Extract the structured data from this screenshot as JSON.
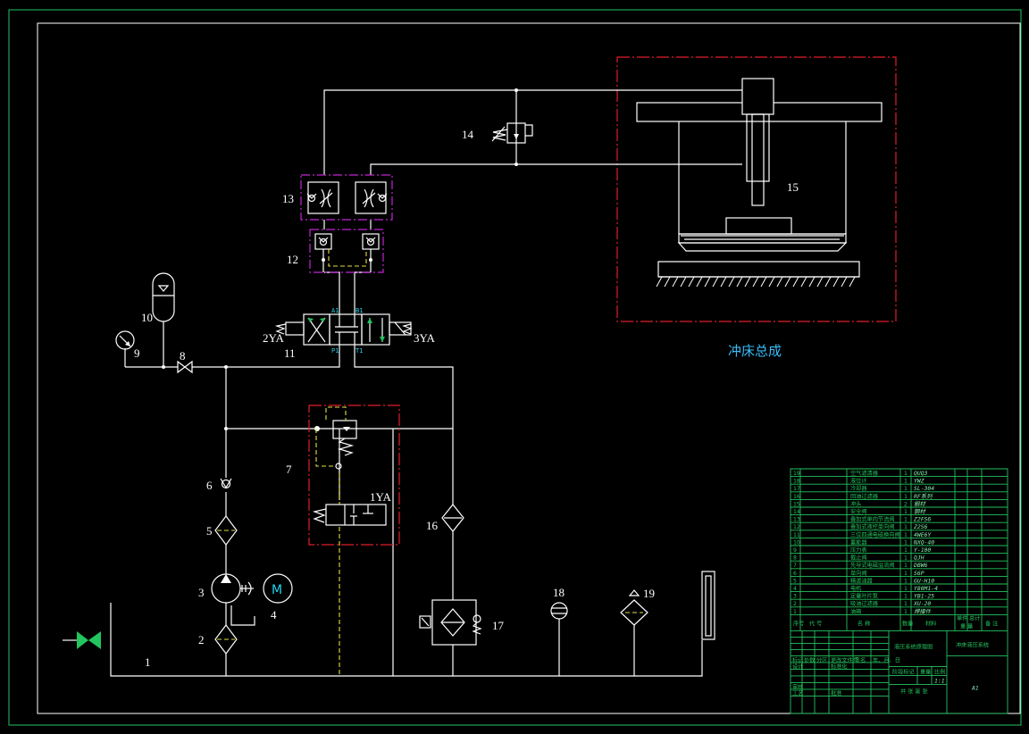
{
  "labels": {
    "n1": "1",
    "n2": "2",
    "n3": "3",
    "n4": "4",
    "n5": "5",
    "n6": "6",
    "n7": "7",
    "n8": "8",
    "n9": "9",
    "n10": "10",
    "n11": "11",
    "n12": "12",
    "n13": "13",
    "n14": "14",
    "n15": "15",
    "n16": "16",
    "n17": "17",
    "n18": "18",
    "n19": "19",
    "sol_1ya": "1YA",
    "sol_2ya": "2YA",
    "sol_3ya": "3YA",
    "port_a1": "A1",
    "port_b1": "B1",
    "port_p1": "P1",
    "port_t1": "T1",
    "motor_m": "M",
    "press_assembly": "冲床总成"
  },
  "title_block": {
    "parts": [
      {
        "no": "19",
        "name": "空气滤清器",
        "qty": "1",
        "spec": "QUQ3"
      },
      {
        "no": "18",
        "name": "液位计",
        "qty": "1",
        "spec": "YWZ"
      },
      {
        "no": "17",
        "name": "冷却器",
        "qty": "1",
        "spec": "SL-304"
      },
      {
        "no": "16",
        "name": "回油过滤器",
        "qty": "1",
        "spec": "RF系列"
      },
      {
        "no": "15",
        "name": "冲头",
        "qty": "2",
        "spec": "钢材"
      },
      {
        "no": "14",
        "name": "安全阀",
        "qty": "1",
        "spec": "钢材"
      },
      {
        "no": "13",
        "name": "叠加式单向节流阀",
        "qty": "1",
        "spec": "Z2FS6"
      },
      {
        "no": "12",
        "name": "叠加式液控单向阀",
        "qty": "1",
        "spec": "Z2S6"
      },
      {
        "no": "11",
        "name": "三位四通电磁换向阀",
        "qty": "1",
        "spec": "4WE6Y"
      },
      {
        "no": "10",
        "name": "蓄能器",
        "qty": "1",
        "spec": "NXQ-40"
      },
      {
        "no": "9",
        "name": "压力表",
        "qty": "1",
        "spec": "Y-100"
      },
      {
        "no": "8",
        "name": "截止阀",
        "qty": "1",
        "spec": "QJH"
      },
      {
        "no": "7",
        "name": "先导式电磁溢流阀",
        "qty": "1",
        "spec": "DBW6"
      },
      {
        "no": "6",
        "name": "单向阀",
        "qty": "1",
        "spec": "S6P"
      },
      {
        "no": "5",
        "name": "精滤油器",
        "qty": "1",
        "spec": "GU-H10"
      },
      {
        "no": "4",
        "name": "电机",
        "qty": "1",
        "spec": "Y80M1-4"
      },
      {
        "no": "3",
        "name": "定量叶片泵",
        "qty": "1",
        "spec": "YB1-25"
      },
      {
        "no": "2",
        "name": "吸油过滤器",
        "qty": "1",
        "spec": "XU-20"
      },
      {
        "no": "1",
        "name": "油箱",
        "qty": "1",
        "spec": "焊接件"
      }
    ],
    "header": {
      "no": "序号",
      "code": "代 号",
      "name": "名 称",
      "qty": "数量",
      "material": "材料",
      "unit_weight": "单件",
      "total_weight": "总计",
      "weight": "重 量",
      "remark": "备 注"
    },
    "drawing_name": "液压系统原理图",
    "project_title": "冲床液压系统",
    "row_labels": [
      "标记",
      "处数",
      "分区",
      "更改文件号",
      "签名",
      "年、月、日"
    ],
    "design": "设计",
    "standardize": "标准化",
    "stage_mark": "阶段标记",
    "weight": "重量",
    "scale": "比例",
    "scale_value": "1:1",
    "audit": "审核",
    "process": "工艺",
    "approve": "批准",
    "sheets": "共 张 第 张",
    "sheet_size": "A1"
  }
}
